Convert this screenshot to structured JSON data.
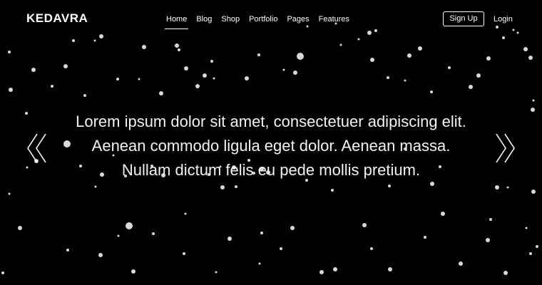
{
  "brand": {
    "name": "KEDAVRA"
  },
  "nav": {
    "items": [
      {
        "label": "Home",
        "active": true
      },
      {
        "label": "Blog",
        "active": false
      },
      {
        "label": "Shop",
        "active": false
      },
      {
        "label": "Portfolio",
        "active": false
      },
      {
        "label": "Pages",
        "active": false
      },
      {
        "label": "Features",
        "active": false
      }
    ]
  },
  "auth": {
    "signup_label": "Sign Up",
    "login_label": "Login"
  },
  "hero": {
    "lines": [
      "Lorem ipsum dolor sit amet, consectetuer adipiscing elit.",
      "Aenean commodo ligula eget dolor. Aenean massa.",
      "Nullam dictum felis eu pede mollis pretium."
    ]
  },
  "slider": {
    "prev_icon": "double-chevron-left-icon",
    "next_icon": "double-chevron-right-icon"
  },
  "colors": {
    "background": "#000000",
    "text": "#ffffff",
    "star": "#dcdcdc"
  }
}
